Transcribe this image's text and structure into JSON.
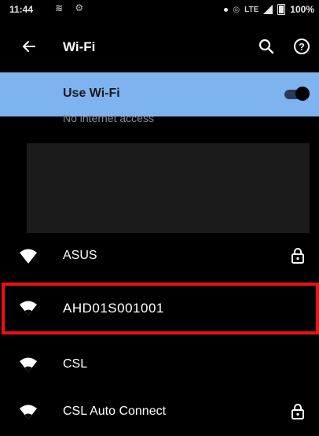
{
  "status_bar": {
    "time": "11:44",
    "left_icons": "≋ ⚙",
    "network": "LTE",
    "battery": "100%"
  },
  "app_bar": {
    "title": "Wi-Fi",
    "icons": [
      "back-arrow-icon",
      "search-icon",
      "help-icon"
    ]
  },
  "use_wifi": {
    "label": "Use Wi-Fi",
    "toggle_on": true
  },
  "sub_status": "No internet access",
  "networks": [
    {
      "name": "ASUS",
      "locked": true
    },
    {
      "name": "AHD01S001001",
      "locked": false,
      "highlighted": true
    },
    {
      "name": "CSL",
      "locked": false
    },
    {
      "name": "CSL Auto Connect",
      "locked": true
    }
  ],
  "colors": {
    "background": "#000000",
    "use_wifi_bg": "#7fb3f0",
    "highlight": "#ee1111",
    "text": "#ffffff"
  }
}
